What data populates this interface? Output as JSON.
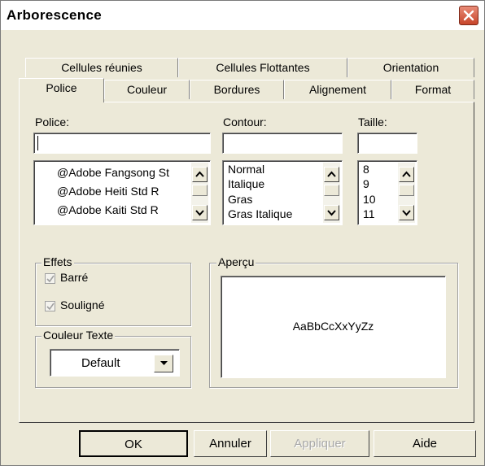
{
  "window": {
    "title": "Arborescence"
  },
  "tabs": {
    "row1": [
      "Cellules réunies",
      "Cellules Flottantes",
      "Orientation"
    ],
    "row2": [
      "Police",
      "Couleur",
      "Bordures",
      "Alignement",
      "Format"
    ],
    "active": "Police"
  },
  "font": {
    "label": "Police:",
    "value": "",
    "items": [
      "@Adobe Fangsong St",
      "@Adobe Heiti Std R",
      "@Adobe Kaiti Std R"
    ]
  },
  "style": {
    "label": "Contour:",
    "value": "",
    "items": [
      "Normal",
      "Italique",
      "Gras",
      "Gras Italique"
    ]
  },
  "size": {
    "label": "Taille:",
    "value": "",
    "items": [
      "8",
      "9",
      "10",
      "11"
    ]
  },
  "effects": {
    "label": "Effets",
    "strike": {
      "label": "Barré",
      "checked": true
    },
    "underline": {
      "label": "Souligné",
      "checked": true
    }
  },
  "text_color": {
    "label": "Couleur Texte",
    "value": "Default"
  },
  "preview": {
    "label": "Aperçu",
    "sample": "AaBbCcXxYyZz"
  },
  "buttons": {
    "ok": "OK",
    "cancel": "Annuler",
    "apply": "Appliquer",
    "help": "Aide"
  },
  "colors": {
    "face": "#ece9d8",
    "close": "#c7452a"
  }
}
